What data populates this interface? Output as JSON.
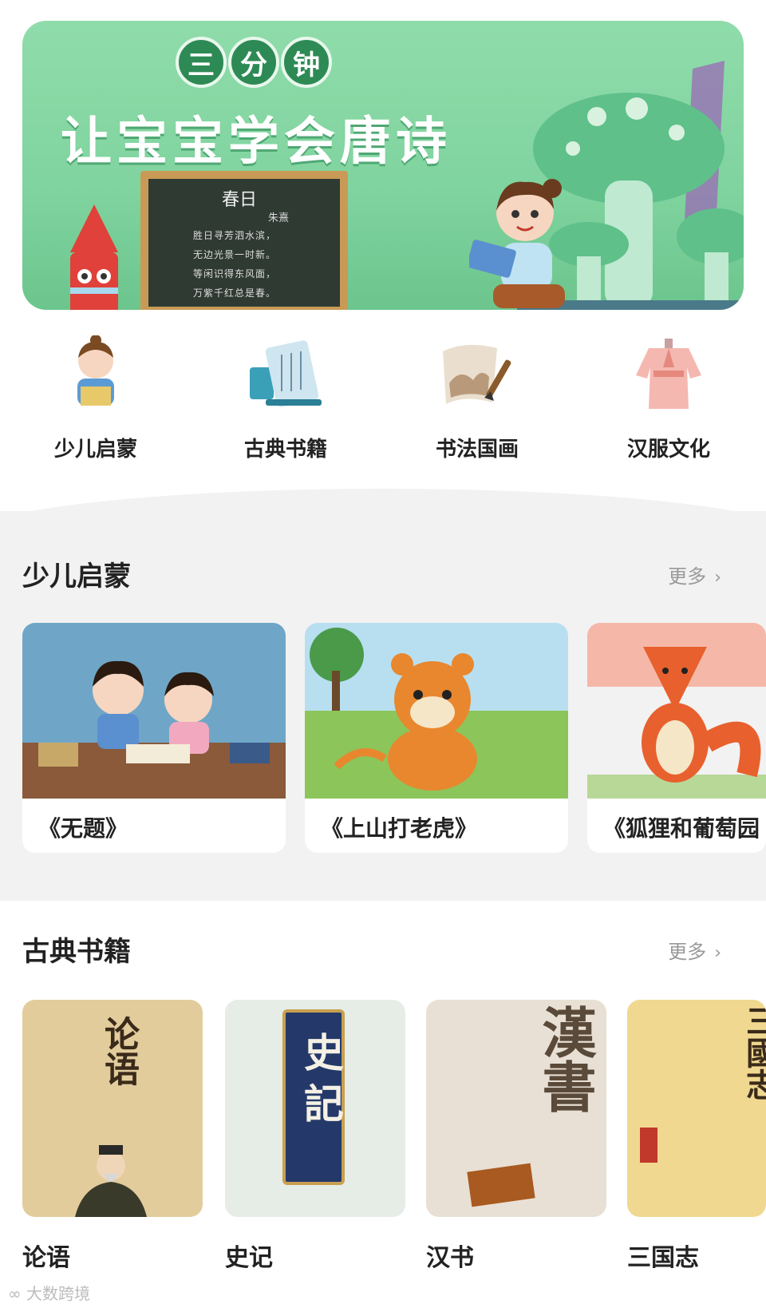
{
  "banner": {
    "badges": [
      "三",
      "分",
      "钟"
    ],
    "title": "让宝宝学会唐诗",
    "poem": {
      "title": "春日",
      "author": "朱熹",
      "lines": [
        "胜日寻芳泗水滨，",
        "无边光景一时新。",
        "等闲识得东风面，",
        "万紫千红总是春。"
      ]
    }
  },
  "categories": [
    {
      "label": "少儿启蒙",
      "icon": "child-reading-icon"
    },
    {
      "label": "古典书籍",
      "icon": "scroll-book-icon"
    },
    {
      "label": "书法国画",
      "icon": "brush-painting-icon"
    },
    {
      "label": "汉服文化",
      "icon": "hanfu-dress-icon"
    }
  ],
  "section1": {
    "title": "少儿启蒙",
    "more": "更多",
    "cards": [
      "《无题》",
      "《上山打老虎》",
      "《狐狸和葡萄园"
    ]
  },
  "section2": {
    "title": "古典书籍",
    "more": "更多",
    "books": [
      {
        "title": "论语",
        "cover_text": "论语"
      },
      {
        "title": "史记",
        "cover_text": "史記"
      },
      {
        "title": "汉书",
        "cover_text": "漢書"
      },
      {
        "title": "三国志",
        "cover_text": "三國志"
      }
    ]
  },
  "watermark": "大数跨境",
  "colors": {
    "banner_green": "#7fd39e",
    "badge_green": "#2e8a55",
    "accent_red": "#e0413a"
  }
}
